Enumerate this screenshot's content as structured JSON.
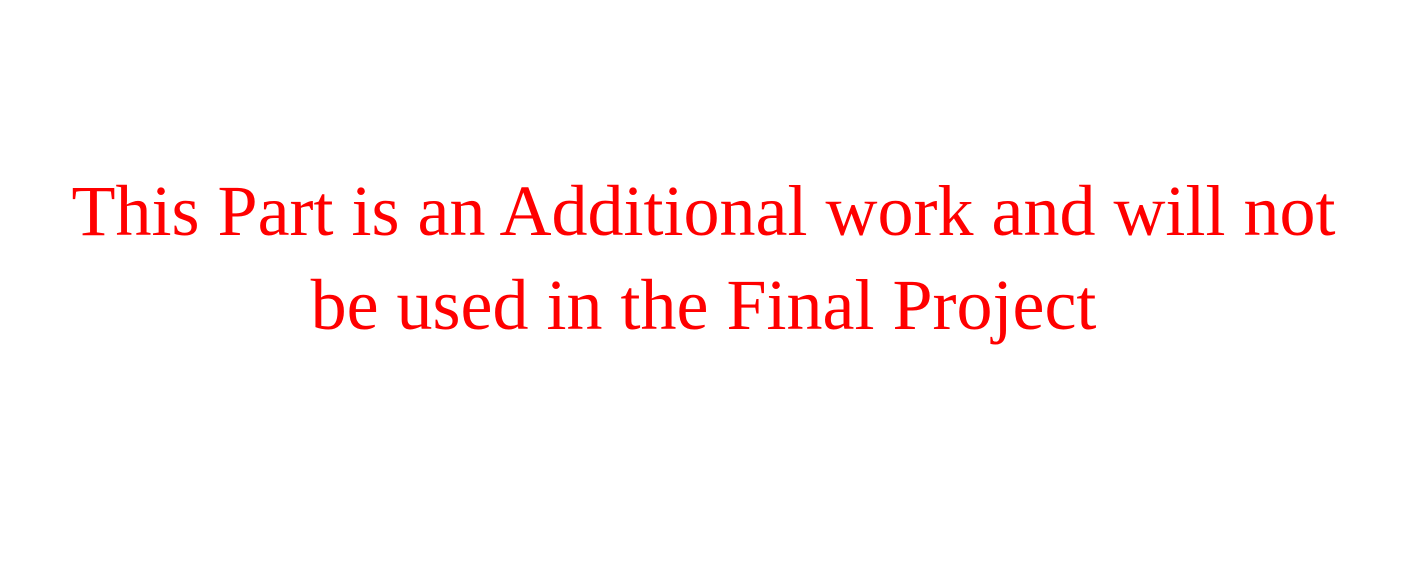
{
  "notice": {
    "line1": "This Part is an Additional work and will not",
    "line2": "be used in the Final Project",
    "color": "#ff0000"
  }
}
